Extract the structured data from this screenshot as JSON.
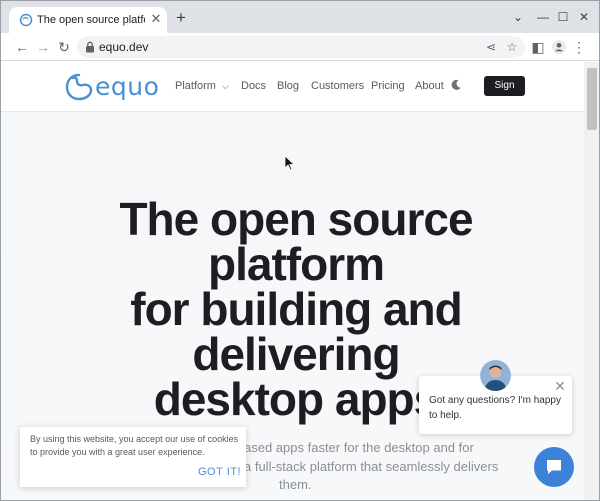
{
  "browser": {
    "tab_title": "The open source platform for b",
    "url": "equo.dev"
  },
  "site": {
    "logo_text": "equo",
    "nav": [
      "Platform",
      "Docs",
      "Blog",
      "Customers",
      "Pricing",
      "About"
    ],
    "sign_label": "Sign"
  },
  "hero": {
    "title_lines": [
      "The open source",
      "platform",
      "for building and",
      "delivering",
      "desktop apps"
    ],
    "subtitle_right_1": "ased apps faster for the desktop and for",
    "subtitle_right_2": "a full-stack platform that seamlessly delivers",
    "subtitle_3": "them."
  },
  "cookie": {
    "text": "By using this website, you accept our use of cookies to provide you with a great user experience.",
    "button": "GOT IT!"
  },
  "chat": {
    "message": "Got any questions? I'm happy to help."
  },
  "colors": {
    "brand_blue": "#4b8fd4",
    "launcher_blue": "#3d82d9",
    "heading": "#1c1e21"
  }
}
